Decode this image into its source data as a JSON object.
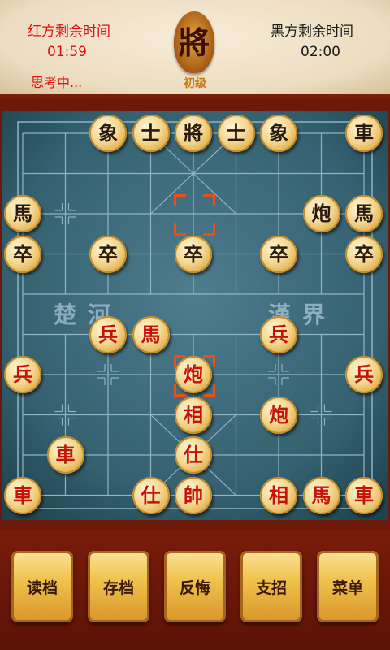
{
  "header": {
    "red_label": "红方剩余时间",
    "red_time": "01:59",
    "red_status": "思考中...",
    "black_label": "黑方剩余时间",
    "black_time": "02:00",
    "emblem_char": "將",
    "level": "初级"
  },
  "board": {
    "river_left": "楚河",
    "river_right": "漢界",
    "pieces": [
      {
        "char": "象",
        "side": "black",
        "file": 2,
        "rank": 0
      },
      {
        "char": "士",
        "side": "black",
        "file": 3,
        "rank": 0
      },
      {
        "char": "將",
        "side": "black",
        "file": 4,
        "rank": 0
      },
      {
        "char": "士",
        "side": "black",
        "file": 5,
        "rank": 0
      },
      {
        "char": "象",
        "side": "black",
        "file": 6,
        "rank": 0
      },
      {
        "char": "車",
        "side": "black",
        "file": 8,
        "rank": 0
      },
      {
        "char": "馬",
        "side": "black",
        "file": 0,
        "rank": 2
      },
      {
        "char": "炮",
        "side": "black",
        "file": 7,
        "rank": 2
      },
      {
        "char": "馬",
        "side": "black",
        "file": 8,
        "rank": 2
      },
      {
        "char": "卒",
        "side": "black",
        "file": 0,
        "rank": 3
      },
      {
        "char": "卒",
        "side": "black",
        "file": 2,
        "rank": 3
      },
      {
        "char": "卒",
        "side": "black",
        "file": 4,
        "rank": 3
      },
      {
        "char": "卒",
        "side": "black",
        "file": 6,
        "rank": 3
      },
      {
        "char": "卒",
        "side": "black",
        "file": 8,
        "rank": 3
      },
      {
        "char": "兵",
        "side": "red",
        "file": 2,
        "rank": 5
      },
      {
        "char": "馬",
        "side": "red",
        "file": 3,
        "rank": 5
      },
      {
        "char": "兵",
        "side": "red",
        "file": 6,
        "rank": 5
      },
      {
        "char": "兵",
        "side": "red",
        "file": 0,
        "rank": 6
      },
      {
        "char": "炮",
        "side": "red",
        "file": 4,
        "rank": 6
      },
      {
        "char": "兵",
        "side": "red",
        "file": 8,
        "rank": 6
      },
      {
        "char": "相",
        "side": "red",
        "file": 4,
        "rank": 7
      },
      {
        "char": "炮",
        "side": "red",
        "file": 6,
        "rank": 7
      },
      {
        "char": "車",
        "side": "red",
        "file": 1,
        "rank": 8
      },
      {
        "char": "仕",
        "side": "red",
        "file": 4,
        "rank": 8
      },
      {
        "char": "車",
        "side": "red",
        "file": 0,
        "rank": 9
      },
      {
        "char": "仕",
        "side": "red",
        "file": 3,
        "rank": 9
      },
      {
        "char": "帥",
        "side": "red",
        "file": 4,
        "rank": 9
      },
      {
        "char": "相",
        "side": "red",
        "file": 6,
        "rank": 9
      },
      {
        "char": "馬",
        "side": "red",
        "file": 7,
        "rank": 9
      },
      {
        "char": "車",
        "side": "red",
        "file": 8,
        "rank": 9
      }
    ],
    "last_move_from": {
      "file": 4,
      "rank": 2
    },
    "last_move_to": {
      "file": 4,
      "rank": 6
    }
  },
  "buttons": [
    {
      "label": "读档",
      "name": "load-game-button"
    },
    {
      "label": "存档",
      "name": "save-game-button"
    },
    {
      "label": "反悔",
      "name": "undo-button"
    },
    {
      "label": "支招",
      "name": "hint-button"
    },
    {
      "label": "菜单",
      "name": "menu-button"
    }
  ]
}
